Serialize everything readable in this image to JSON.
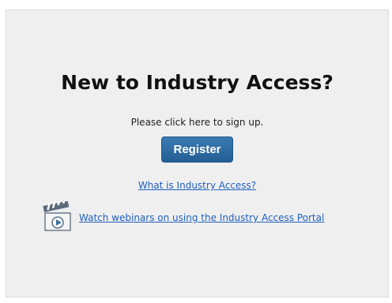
{
  "title": "New to Industry Access?",
  "subtitle": "Please click here to sign up.",
  "register_label": "Register",
  "what_link": "What is Industry Access?",
  "webinar_link": "Watch webinars on using the Industry Access Portal",
  "icons": {
    "webinar": "video-clapperboard-icon"
  },
  "colors": {
    "button": "#2d6a9f",
    "link": "#1f5fbf",
    "panel": "#efefef"
  }
}
